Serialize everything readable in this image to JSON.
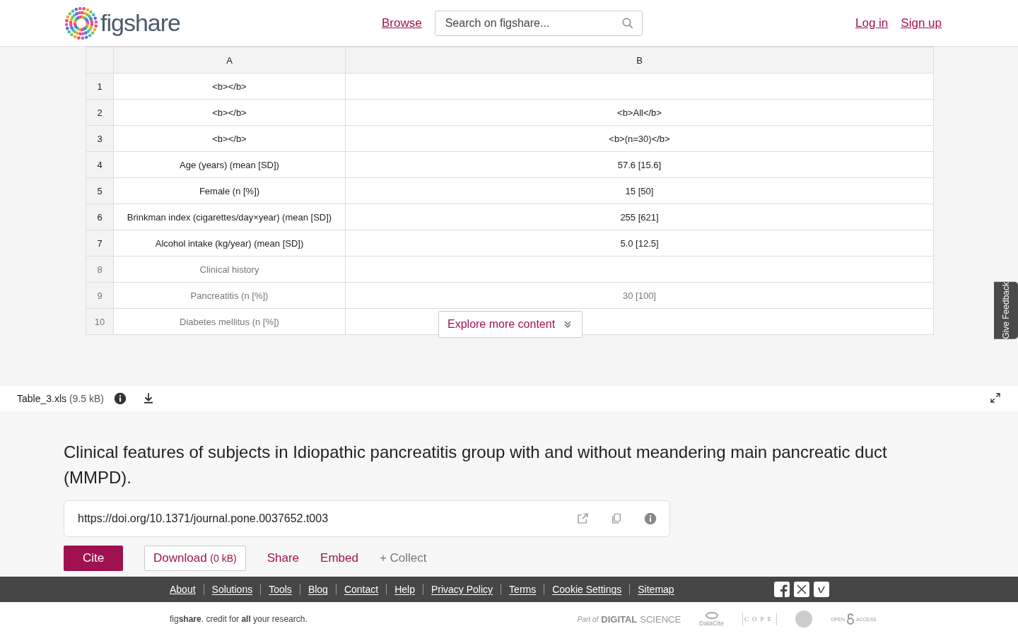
{
  "header": {
    "logo": "figshare",
    "nav": [
      {
        "label": "Browse"
      }
    ],
    "search": {
      "placeholder": "Search on figshare..."
    },
    "account": [
      {
        "label": "Log in"
      },
      {
        "label": "Sign up"
      }
    ]
  },
  "table": {
    "columns": [
      "A",
      "B"
    ],
    "rows": [
      {
        "index": "1",
        "cells": [
          "<b></b>",
          ""
        ],
        "faded": false
      },
      {
        "index": "2",
        "cells": [
          "<b></b>",
          "<b>All</b>"
        ],
        "faded": false
      },
      {
        "index": "3",
        "cells": [
          "<b></b>",
          "<b>(n=30)</b>"
        ],
        "faded": false
      },
      {
        "index": "4",
        "cells": [
          "Age (years) (mean [SD])",
          "57.6 [15.6]"
        ],
        "faded": false
      },
      {
        "index": "5",
        "cells": [
          "Female (n [%])",
          "15 [50]"
        ],
        "faded": false
      },
      {
        "index": "6",
        "cells": [
          "Brinkman index (cigarettes/day×year) (mean [SD])",
          "255 [621]"
        ],
        "faded": false
      },
      {
        "index": "7",
        "cells": [
          "Alcohol intake (kg/year) (mean [SD])",
          "5.0 [12.5]"
        ],
        "faded": false
      },
      {
        "index": "8",
        "cells": [
          "Clinical history",
          ""
        ],
        "faded": true
      },
      {
        "index": "9",
        "cells": [
          "Pancreatitis (n [%])",
          "30 [100]"
        ],
        "faded": true
      },
      {
        "index": "10",
        "cells": [
          "Diabetes mellitus (n [%])",
          ""
        ],
        "faded": true
      }
    ]
  },
  "explore_button": "Explore more content",
  "feedback_tab": "Give Feedback",
  "file_bar": {
    "name": "Table_3.xls",
    "size": "(9.5 kB)"
  },
  "item": {
    "title": "Clinical features of subjects in Idiopathic pancreatitis group with and without meandering main pancreatic duct (MMPD).",
    "doi": "https://doi.org/10.1371/journal.pone.0037652.t003",
    "actions": [
      {
        "kind": "primary",
        "label": "Cite"
      },
      {
        "kind": "outlined",
        "label": "Download",
        "note": "(0 kB)"
      },
      {
        "kind": "link",
        "label": "Share"
      },
      {
        "kind": "link",
        "label": "Embed"
      },
      {
        "kind": "muted",
        "label": "+ Collect"
      }
    ]
  },
  "footer": {
    "links": [
      "About",
      "Solutions",
      "Tools",
      "Blog",
      "Contact",
      "Help",
      "Privacy Policy",
      "Terms",
      "Cookie Settings",
      "Sitemap"
    ],
    "tagline": "fig**share**. credit for **all** your research.",
    "partners": [
      {
        "kind": "digital-science",
        "label": "DIGITAL",
        "extra": "SCIENCE",
        "prefix": "Part of"
      },
      {
        "kind": "datacite",
        "label": "DataCite"
      },
      {
        "kind": "cope",
        "label": "COPE"
      },
      {
        "kind": "seal"
      },
      {
        "kind": "open-access",
        "label": "OPEN",
        "extra": "ACCESS"
      }
    ]
  }
}
